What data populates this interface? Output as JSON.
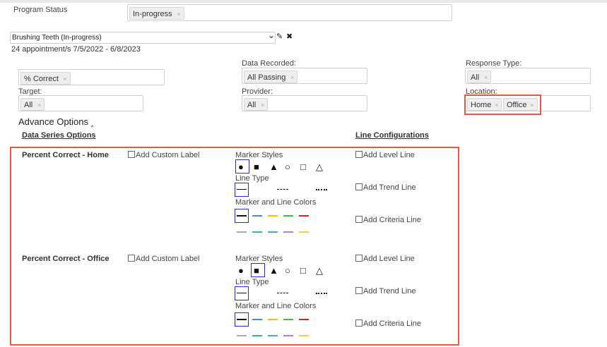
{
  "program_status": {
    "label": "Program Status",
    "chip": "In-progress"
  },
  "program_select": {
    "value": "Brushing Teeth (In-progress)",
    "caret": "⌄",
    "edit_glyph": "✎",
    "close_glyph": "✖"
  },
  "appointments_text": "24 appointment/s 7/5/2022 - 6/8/2023",
  "filters": {
    "measure": {
      "chip": "% Correct"
    },
    "data_recorded": {
      "label": "Data Recorded:",
      "chip": "All Passing"
    },
    "response_type": {
      "label": "Response Type:",
      "chip": "All"
    },
    "target": {
      "label": "Target:",
      "chip": "All"
    },
    "provider": {
      "label": "Provider:",
      "chip": "All"
    },
    "location": {
      "label": "Location:",
      "chips": [
        "Home",
        "Office"
      ]
    }
  },
  "chip_remove_glyph": "×",
  "advance_options": {
    "title": "Advance Options",
    "caret": "‸"
  },
  "headers": {
    "data_series": "Data Series Options",
    "line_config": "Line Configurations"
  },
  "series": [
    {
      "name": "Percent Correct - Home",
      "custom_label": "Add Custom Label",
      "marker_styles_label": "Marker Styles",
      "line_type_label": "Line Type",
      "colors_label": "Marker and Line Colors",
      "level_line": "Add Level Line",
      "trend_line": "Add Trend Line",
      "criteria_line": "Add Criteria Line",
      "selected_marker": "circle"
    },
    {
      "name": "Percent Correct - Office",
      "custom_label": "Add Custom Label",
      "marker_styles_label": "Marker Styles",
      "line_type_label": "Line Type",
      "colors_label": "Marker and Line Colors",
      "level_line": "Add Level Line",
      "trend_line": "Add Trend Line",
      "criteria_line": "Add Criteria Line",
      "selected_marker": "square"
    }
  ],
  "marker_glyphs": [
    "●",
    "■",
    "▲",
    "○",
    "□",
    "△"
  ],
  "line_colors_row1": [
    "#111111",
    "#3a8ee6",
    "#f2c200",
    "#3cc13c",
    "#e02020"
  ],
  "line_colors_row2": [
    "#aaaaaa",
    "#2fbf8f",
    "#4aa3e6",
    "#b57ad6",
    "#f2d04a"
  ],
  "accent_colors": {
    "highlight": "#e55a3c",
    "selected": "#2b2bd6"
  }
}
